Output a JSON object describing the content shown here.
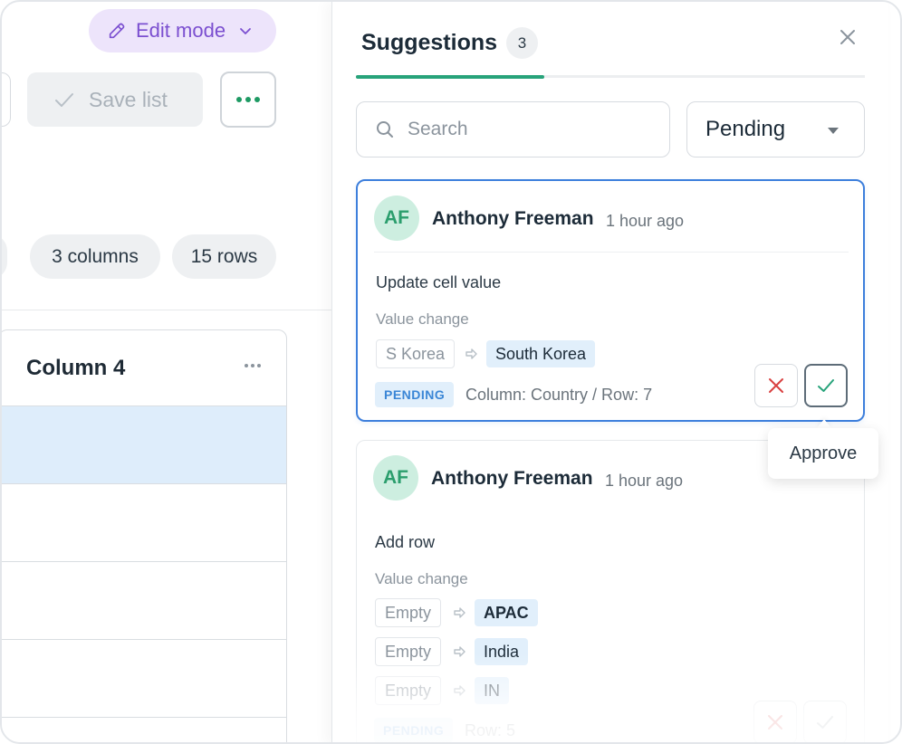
{
  "toolbar": {
    "edit_mode_label": "Edit mode",
    "save_list_label": "Save list",
    "accent_color": "#7b4fd0"
  },
  "chips": {
    "columns": "3 columns",
    "rows": "15 rows"
  },
  "table": {
    "header": "Column 4",
    "rows": [
      "",
      "",
      "",
      ""
    ],
    "selected_row": 0
  },
  "panel": {
    "title": "Suggestions",
    "count": "3",
    "search_placeholder": "Search",
    "filter_value": "Pending",
    "tab_accent": "#27a37a"
  },
  "suggestions": [
    {
      "initials": "AF",
      "author": "Anthony Freeman",
      "time": "1 hour ago",
      "action": "Update cell value",
      "value_change_label": "Value change",
      "changes": [
        {
          "old": "S Korea",
          "new": "South Korea"
        }
      ],
      "status": "PENDING",
      "meta": "Column: Country / Row: 7"
    },
    {
      "initials": "AF",
      "author": "Anthony Freeman",
      "time": "1 hour ago",
      "action": "Add row",
      "value_change_label": "Value change",
      "changes": [
        {
          "old": "Empty",
          "new": "APAC"
        },
        {
          "old": "Empty",
          "new": "India"
        },
        {
          "old": "Empty",
          "new": "IN"
        }
      ],
      "status": "PENDING",
      "meta": "Row: 5"
    }
  ],
  "tooltip": {
    "text": "Approve"
  },
  "icons": {
    "pencil": "pencil-icon",
    "chevron": "chevron-down-icon",
    "check": "check-icon",
    "more": "more-horizontal-icon",
    "close": "close-icon",
    "search": "search-icon",
    "caret": "caret-down-icon",
    "arrow": "arrow-right-icon",
    "reject": "x-icon",
    "approve": "check-icon"
  }
}
